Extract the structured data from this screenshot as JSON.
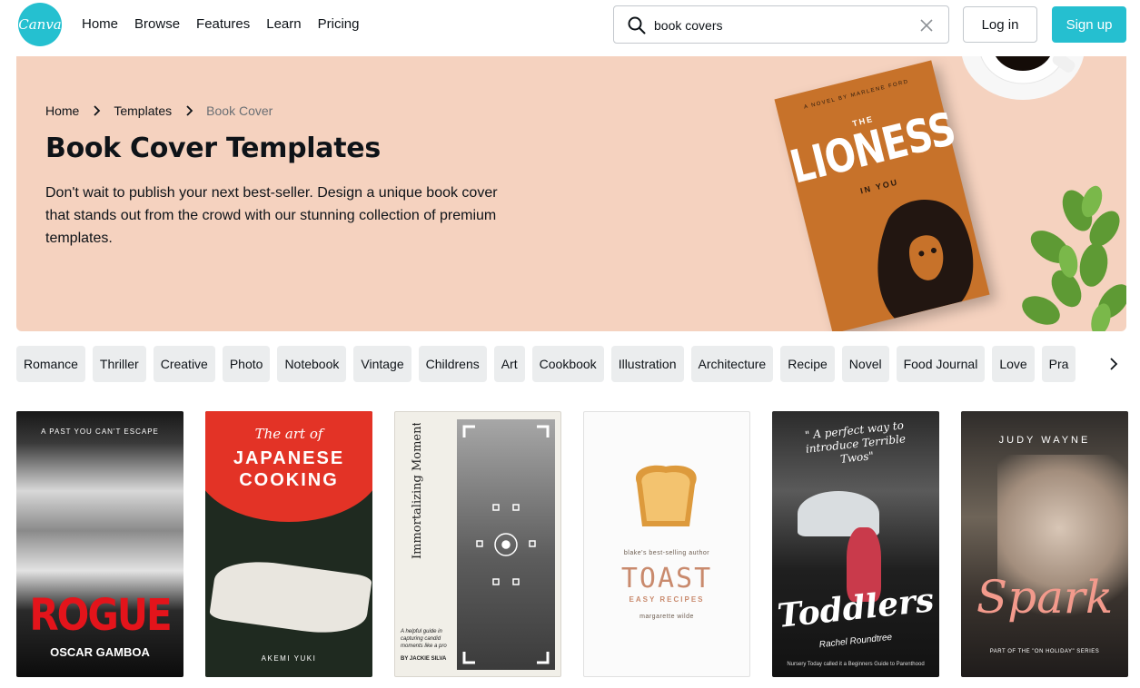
{
  "header": {
    "logo_text": "Canva",
    "nav": [
      "Home",
      "Browse",
      "Features",
      "Learn",
      "Pricing"
    ],
    "search": {
      "value": "book covers"
    },
    "login_label": "Log in",
    "signup_label": "Sign up",
    "accent_color": "#25bfd0"
  },
  "hero": {
    "breadcrumb": [
      "Home",
      "Templates",
      "Book Cover"
    ],
    "title": "Book Cover Templates",
    "description": "Don't wait to publish your next best-seller. Design a unique book cover that stands out from the crowd with our stunning collection of premium templates.",
    "background_color": "#f5d2bf",
    "book": {
      "byline": "A NOVEL BY MARLENE FORD",
      "the": "THE",
      "title": "LIONESS",
      "subtitle": "IN YOU"
    }
  },
  "filters": [
    "Romance",
    "Thriller",
    "Creative",
    "Photo",
    "Notebook",
    "Vintage",
    "Childrens",
    "Art",
    "Cookbook",
    "Illustration",
    "Architecture",
    "Recipe",
    "Novel",
    "Food Journal",
    "Love",
    "Pra"
  ],
  "cards": [
    {
      "top_text": "A PAST YOU CAN'T ESCAPE",
      "title": "ROGUE",
      "author": "OSCAR GAMBOA"
    },
    {
      "top_text": "The art of",
      "title": "JAPANESE COOKING",
      "author": "AKEMI YUKI"
    },
    {
      "title": "Immortalizing Moments: Candid Photography",
      "guide": "A helpful guide in capturing candid moments like a pro",
      "author": "BY JACKIE SILVA"
    },
    {
      "blurb": "blake's best-selling author",
      "title": "TOAST",
      "subtitle": "EASY RECIPES",
      "author": "margarette wilde"
    },
    {
      "quote": "\" A perfect way to introduce Terrible Twos\"",
      "title": "Toddlers",
      "author": "Rachel Roundtree",
      "footer": "Nursery Today called it a Beginners Guide to Parenthood"
    },
    {
      "author": "JUDY WAYNE",
      "title": "Spark",
      "footer": "PART OF THE \"ON HOLIDAY\" SERIES"
    }
  ]
}
